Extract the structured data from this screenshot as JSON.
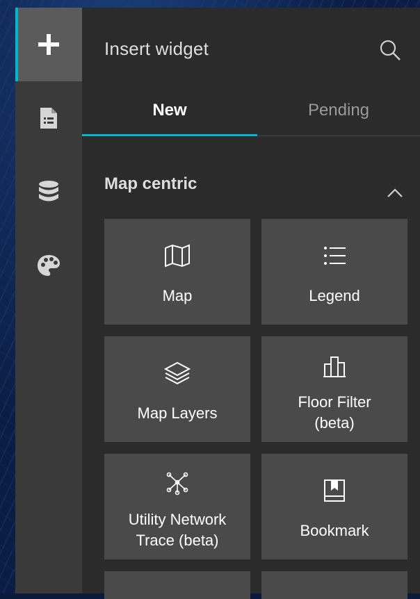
{
  "panel": {
    "title": "Insert widget"
  },
  "rail": {
    "items": [
      {
        "icon": "plus-icon",
        "active": true
      },
      {
        "icon": "page-icon",
        "active": false
      },
      {
        "icon": "data-icon",
        "active": false
      },
      {
        "icon": "palette-icon",
        "active": false
      }
    ]
  },
  "tabs": [
    {
      "label": "New",
      "active": true
    },
    {
      "label": "Pending",
      "active": false
    }
  ],
  "section": {
    "title": "Map centric",
    "expanded": true
  },
  "widgets": [
    {
      "label": "Map",
      "icon": "map-icon"
    },
    {
      "label": "Legend",
      "icon": "legend-icon"
    },
    {
      "label": "Map Layers",
      "icon": "layers-icon"
    },
    {
      "label": "Floor Filter\n(beta)",
      "icon": "floor-filter-icon"
    },
    {
      "label": "Utility Network\nTrace (beta)",
      "icon": "network-trace-icon"
    },
    {
      "label": "Bookmark",
      "icon": "bookmark-icon"
    }
  ],
  "colors": {
    "accent": "#00b8cc",
    "panel_bg": "#2b2b2b",
    "rail_bg": "#3a3a3a",
    "card_bg": "#4a4a4a"
  }
}
